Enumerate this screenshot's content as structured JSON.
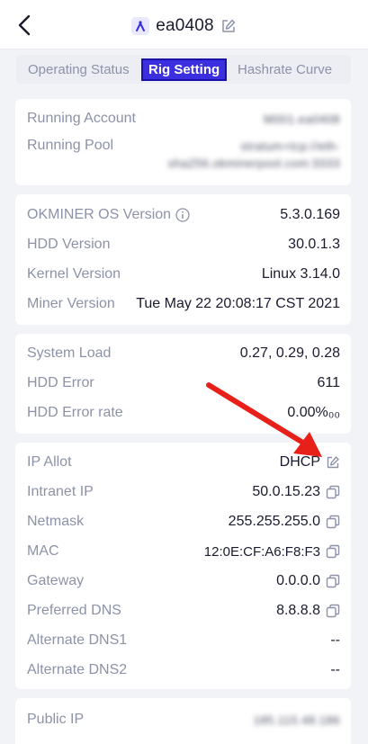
{
  "header": {
    "title": "ea0408"
  },
  "tabs": [
    {
      "label": "Operating Status"
    },
    {
      "label": "Rig Setting"
    },
    {
      "label": "Hashrate Curve"
    }
  ],
  "account": {
    "running_account_label": "Running Account",
    "running_account_value": "M001.ea0408",
    "running_pool_label": "Running Pool",
    "running_pool_value_1": "stratum+tcp://eth-",
    "running_pool_value_2": "sha256.okminerpool.com:3333"
  },
  "versions": {
    "os_label": "OKMINER OS Version",
    "os_value": "5.3.0.169",
    "hdd_label": "HDD Version",
    "hdd_value": "30.0.1.3",
    "kernel_label": "Kernel Version",
    "kernel_value": "Linux 3.14.0",
    "miner_label": "Miner Version",
    "miner_value": "Tue May 22 20:08:17 CST 2021"
  },
  "system": {
    "load_label": "System Load",
    "load_value": "0.27, 0.29, 0.28",
    "hdd_error_label": "HDD Error",
    "hdd_error_value": "611",
    "hdd_error_rate_label": "HDD Error rate",
    "hdd_error_rate_value": "0.00%₀₀"
  },
  "network": {
    "ip_allot_label": "IP Allot",
    "ip_allot_value": "DHCP",
    "intranet_ip_label": "Intranet IP",
    "intranet_ip_value": "50.0.15.23",
    "netmask_label": "Netmask",
    "netmask_value": "255.255.255.0",
    "mac_label": "MAC",
    "mac_value": "12:0E:CF:A6:F8:F3",
    "gateway_label": "Gateway",
    "gateway_value": "0.0.0.0",
    "preferred_dns_label": "Preferred DNS",
    "preferred_dns_value": "8.8.8.8",
    "alternate_dns1_label": "Alternate DNS1",
    "alternate_dns1_value": "--",
    "alternate_dns2_label": "Alternate DNS2",
    "alternate_dns2_value": "--"
  },
  "public": {
    "public_ip_label": "Public IP",
    "public_ip_value": "185.115.48.186"
  },
  "colors": {
    "accent": "#3b2fe0",
    "label": "#8d92a8",
    "value": "#1a1b2e",
    "background": "#f2f3f6",
    "arrow": "#e8201a"
  }
}
